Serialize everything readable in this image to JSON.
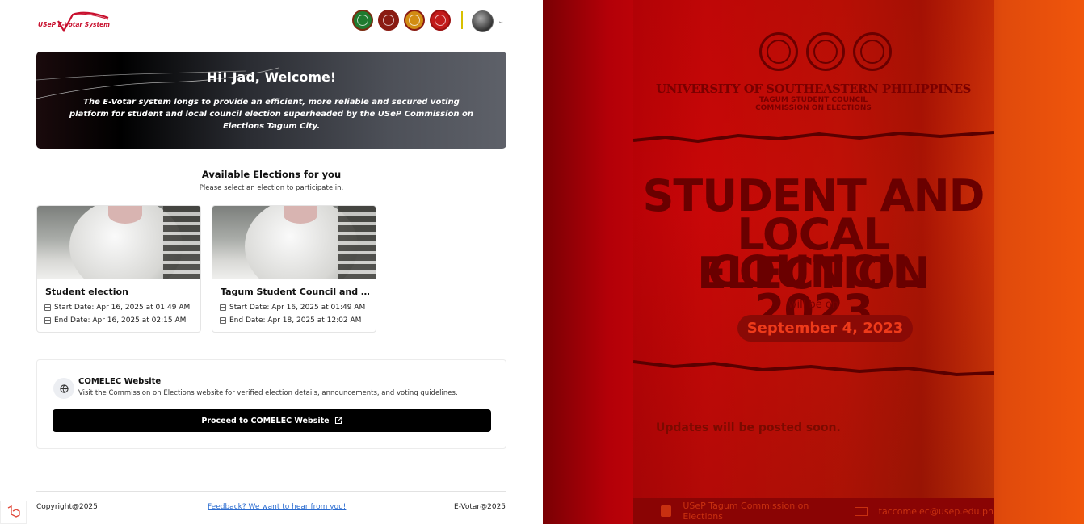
{
  "brand": {
    "logo_text": "USeP E-Votar System",
    "accent": "#c8102e"
  },
  "header": {
    "seal_colors": [
      "#1e7a2e",
      "#8a1b12",
      "#d28c12",
      "#c21a1a"
    ],
    "avatar_icon": "user-avatar",
    "caret_icon": "chevron-down-icon"
  },
  "welcome": {
    "title": "Hi! Jad, Welcome!",
    "text": "The E-Votar system longs to provide an efficient, more reliable and secured voting platform for student and local council election superheaded by the USeP Commission on Elections Tagum City."
  },
  "elections": {
    "title": "Available Elections for you",
    "subtitle": "Please select an election to participate in.",
    "cards": [
      {
        "title": "Student election",
        "start": "Start Date: Apr 16, 2025 at 01:49 AM",
        "end": "End Date: Apr 16, 2025 at 02:15 AM"
      },
      {
        "title": "Tagum Student Council and Local Council",
        "start": "Start Date: Apr 16, 2025 at 01:49 AM",
        "end": "End Date: Apr 18, 2025 at 12:02 AM"
      }
    ]
  },
  "comelec": {
    "title": "COMELEC Website",
    "description": "Visit the Commission on Elections website for verified election details, announcements, and voting guidelines.",
    "button": "Proceed to COMELEC Website"
  },
  "footer": {
    "copyright": "Copyright@2025",
    "feedback": "Feedback? We want to hear from you!",
    "brand": "E-Votar@2025"
  },
  "poster": {
    "university": "UNIVERSITY OF SOUTHEASTERN PHILIPPINES",
    "council": "TAGUM STUDENT COUNCIL",
    "commission": "COMMISSION ON ELECTIONS",
    "line1": "STUDENT AND",
    "line2": "LOCAL COUNCIL",
    "line3": "ELECTION 2023",
    "will_be_on": "will be on",
    "date": "September 4, 2023",
    "updates": "Updates will be posted soon.",
    "facebook": "USeP Tagum Commission on Elections",
    "email": "taccomelec@usep.edu.ph"
  }
}
